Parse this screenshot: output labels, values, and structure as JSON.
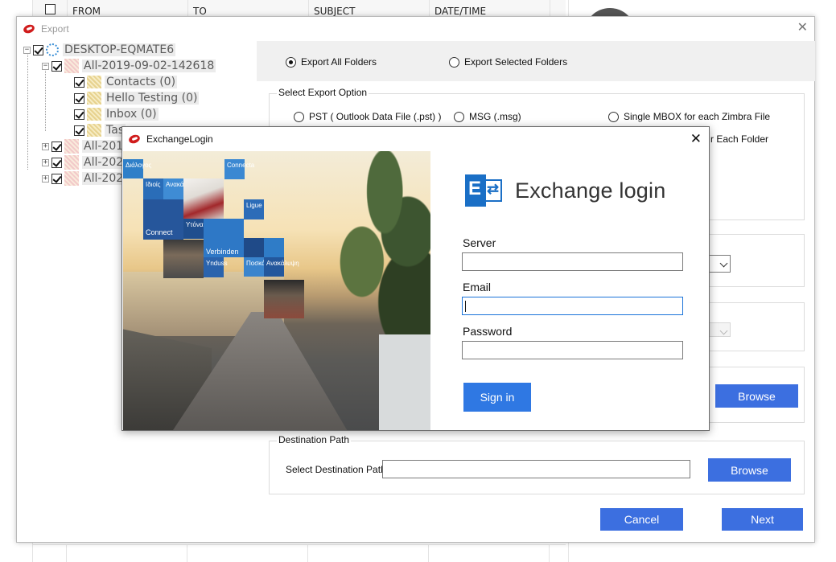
{
  "background": {
    "columns": [
      "FROM",
      "TO",
      "SUBJECT",
      "DATE/TIME"
    ]
  },
  "export_window": {
    "title": "Export",
    "close_glyph": "✕",
    "tree": {
      "root": "DESKTOP-EQMATE6",
      "store": "All-2019-09-02-142618",
      "folders": [
        "Contacts (0)",
        "Hello Testing (0)",
        "Inbox (0)",
        "Tas"
      ],
      "collapsed_stores": [
        "All-201",
        "All-202",
        "All-202"
      ]
    },
    "scope": {
      "all_label": "Export All Folders",
      "selected_label": "Export Selected Folders",
      "selected": "all"
    },
    "export_option": {
      "caption": "Select Export Option",
      "pst": "PST ( Outlook Data File (.pst) )",
      "msg": "MSG  (.msg)",
      "mbox": "Single MBOX for each Zimbra File",
      "partial": "r Each Folder"
    },
    "browse_label": "Browse",
    "destination": {
      "caption": "Destination Path",
      "label": "Select Destination Path",
      "value": "",
      "browse_label": "Browse"
    },
    "cancel_label": "Cancel",
    "next_label": "Next"
  },
  "exchange_login": {
    "title": "ExchangeLogin",
    "close_glyph": "✕",
    "heading": "Exchange login",
    "logo_letter": "E",
    "server_label": "Server",
    "server_value": "",
    "email_label": "Email",
    "email_value": "",
    "password_label": "Password",
    "password_value": "",
    "signin_label": "Sign in",
    "tiles": [
      "Διάλογος",
      "Ιδιοίς",
      "Ανακάλυψη",
      "Connect",
      "Verbinden",
      "Υτόνα",
      "Connecta",
      "Ligue",
      "Ynduss",
      "Ποσκάβι",
      "Ανακάλυψη"
    ]
  },
  "colors": {
    "accent": "#3c6fe0",
    "signin": "#2f78e3",
    "exchange_blue": "#1a6fc6",
    "brand_red": "#d01c1c"
  },
  "icons": {
    "app": "lips-logo-icon",
    "computer": "computer-icon",
    "folder": "folder-icon",
    "exchange": "exchange-logo-icon"
  }
}
